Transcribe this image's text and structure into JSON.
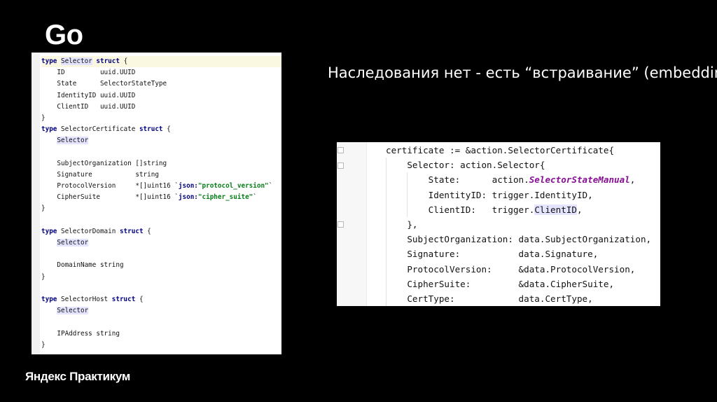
{
  "slide": {
    "title": "Go",
    "subtitle": "Наследования нет - есть “встраивание”   (embedding)",
    "brand": "Яндекс Практикум"
  },
  "colors": {
    "background": "#000000",
    "keyword": "#000080",
    "string": "#067d17",
    "highlight": "#e4e4ff",
    "italic_field": "#871094"
  },
  "left_code": {
    "lines": [
      [
        {
          "t": "type",
          "c": "kw"
        },
        {
          "t": " "
        },
        {
          "t": "Selector",
          "c": "ref"
        },
        {
          "t": " "
        },
        {
          "t": "struct",
          "c": "kw"
        },
        {
          "t": " {"
        }
      ],
      [
        {
          "t": "    ID         uuid.UUID"
        }
      ],
      [
        {
          "t": "    State      SelectorStateType"
        }
      ],
      [
        {
          "t": "    IdentityID uuid.UUID"
        }
      ],
      [
        {
          "t": "    ClientID   uuid.UUID"
        }
      ],
      [
        {
          "t": "}"
        }
      ],
      [
        {
          "t": "type",
          "c": "kw"
        },
        {
          "t": " SelectorCertificate "
        },
        {
          "t": "struct",
          "c": "kw"
        },
        {
          "t": " {"
        }
      ],
      [
        {
          "t": "    "
        },
        {
          "t": "Selector",
          "c": "ref"
        }
      ],
      [
        {
          "t": ""
        }
      ],
      [
        {
          "t": "    SubjectOrganization []string"
        }
      ],
      [
        {
          "t": "    Signature           string"
        }
      ],
      [
        {
          "t": "    ProtocolVersion     *[]uint16 `"
        },
        {
          "t": "json:",
          "c": "kw"
        },
        {
          "t": "\"protocol_version\"",
          "c": "str"
        },
        {
          "t": "`"
        }
      ],
      [
        {
          "t": "    CipherSuite         *[]uint16 `"
        },
        {
          "t": "json:",
          "c": "kw"
        },
        {
          "t": "\"cipher_suite\"",
          "c": "str"
        },
        {
          "t": "`"
        }
      ],
      [
        {
          "t": "}"
        }
      ],
      [
        {
          "t": ""
        }
      ],
      [
        {
          "t": "type",
          "c": "kw"
        },
        {
          "t": " SelectorDomain "
        },
        {
          "t": "struct",
          "c": "kw"
        },
        {
          "t": " {"
        }
      ],
      [
        {
          "t": "    "
        },
        {
          "t": "Selector",
          "c": "ref"
        }
      ],
      [
        {
          "t": ""
        }
      ],
      [
        {
          "t": "    DomainName string"
        }
      ],
      [
        {
          "t": "}"
        }
      ],
      [
        {
          "t": ""
        }
      ],
      [
        {
          "t": "type",
          "c": "kw"
        },
        {
          "t": " SelectorHost "
        },
        {
          "t": "struct",
          "c": "kw"
        },
        {
          "t": " {"
        }
      ],
      [
        {
          "t": "    "
        },
        {
          "t": "Selector",
          "c": "ref"
        }
      ],
      [
        {
          "t": ""
        }
      ],
      [
        {
          "t": "    IPAddress string"
        }
      ],
      [
        {
          "t": "}"
        }
      ]
    ]
  },
  "right_code": {
    "lines": [
      [
        {
          "t": "certificate := &action.SelectorCertificate{"
        }
      ],
      [
        {
          "t": "    Selector: action.Selector{"
        }
      ],
      [
        {
          "t": "        State:      action."
        },
        {
          "t": "SelectorStateManual",
          "c": "it"
        },
        {
          "t": ","
        }
      ],
      [
        {
          "t": "        IdentityID: trigger.IdentityID,"
        }
      ],
      [
        {
          "t": "        ClientID:   trigger."
        },
        {
          "t": "ClientID",
          "c": "ref"
        },
        {
          "t": ","
        }
      ],
      [
        {
          "t": "    },"
        }
      ],
      [
        {
          "t": "    SubjectOrganization: data.SubjectOrganization,"
        }
      ],
      [
        {
          "t": "    Signature:           data.Signature,"
        }
      ],
      [
        {
          "t": "    ProtocolVersion:     &data.ProtocolVersion,"
        }
      ],
      [
        {
          "t": "    CipherSuite:         &data.CipherSuite,"
        }
      ],
      [
        {
          "t": "    CertType:            data.CertType,"
        }
      ]
    ]
  }
}
